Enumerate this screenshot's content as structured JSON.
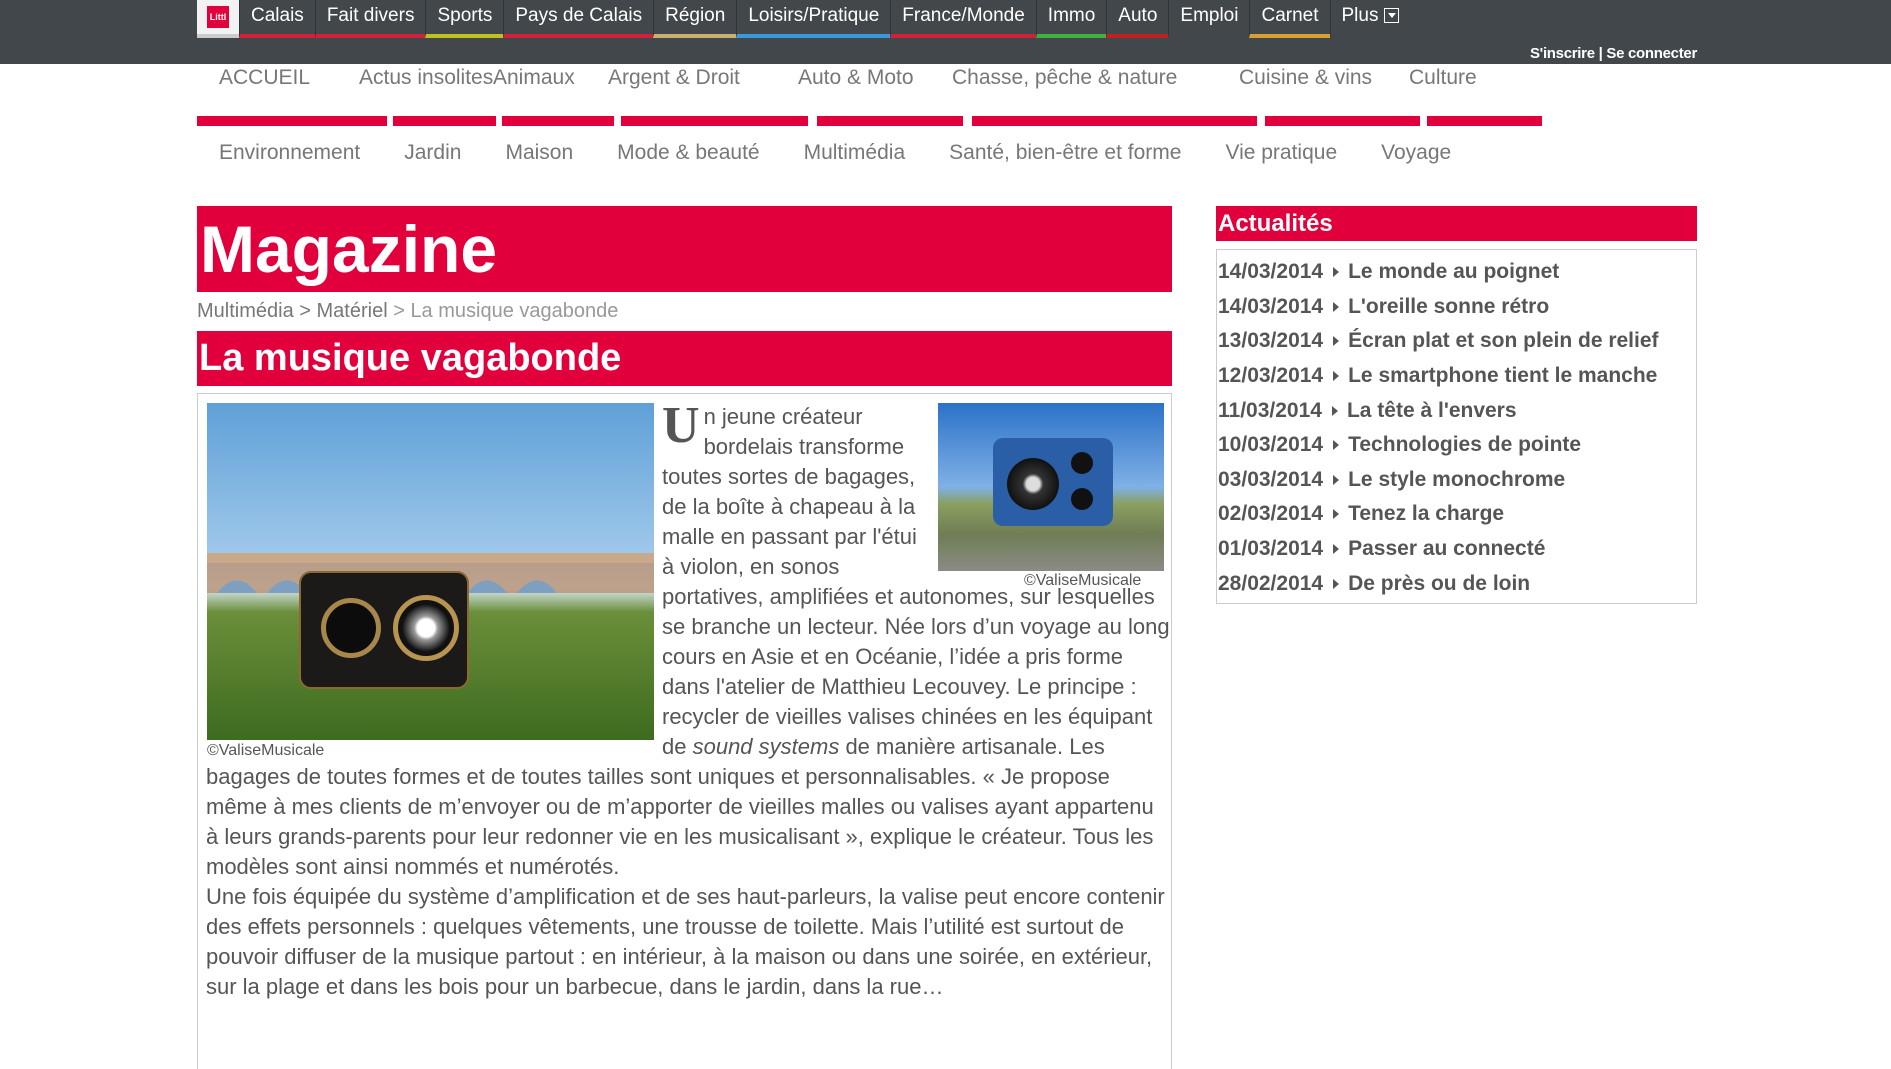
{
  "topnav": {
    "logo_text": "Nord Littoral",
    "tabs": [
      {
        "label": "Calais",
        "color": "#d0203a"
      },
      {
        "label": "Fait divers",
        "color": "#d0203a"
      },
      {
        "label": "Sports",
        "color": "#c0c020"
      },
      {
        "label": "Pays de Calais",
        "color": "#d0203a"
      },
      {
        "label": "Région",
        "color": "#c8b070"
      },
      {
        "label": "Loisirs/Pratique",
        "color": "#3a9ad9"
      },
      {
        "label": "France/Monde",
        "color": "#d0203a"
      },
      {
        "label": "Immo",
        "color": "#40b040"
      },
      {
        "label": "Auto",
        "color": "#c02020"
      },
      {
        "label": "Emploi",
        "color": "#41474b"
      },
      {
        "label": "Carnet",
        "color": "#d8a030"
      },
      {
        "label": "Plus",
        "color": "#41474b"
      }
    ],
    "auth": {
      "signup": "S'inscrire",
      "separator": " | ",
      "login": "Se connecter"
    }
  },
  "categories": {
    "row1": [
      "ACCUEIL",
      "Actus insolites",
      "Animaux",
      "Argent & Droit",
      "Auto & Moto",
      "Chasse, pêche & nature",
      "Cuisine & vins",
      "Culture"
    ],
    "row2": [
      "Environnement",
      "Jardin",
      "Maison",
      "Mode & beauté",
      "Multimédia",
      "Santé, bien-être et forme",
      "Vie pratique",
      "Voyage"
    ]
  },
  "main": {
    "section_title": "Magazine",
    "breadcrumb": {
      "part1": "Multimédia",
      "sep": " > ",
      "part2": "Matériel",
      "current": "La musique vagabonde"
    },
    "article_title": "La musique vagabonde",
    "photo_left_caption": "©ValiseMusicale",
    "photo_right_caption": "©ValiseMusicale",
    "dropcap": "U",
    "para1_start": "n jeune créateur bordelais transforme toutes sortes de bagages, de la boîte à chapeau à la malle en passant par l'étui à violon, en sonos portatives, amplifiées et autonomes, sur lesquelles se branche un lecteur. Née lors d’un voyage au long cours en Asie et en Océanie, l’idée a pris forme dans l'atelier de Matthieu Lecouvey. Le principe : recycler de vieilles valises chinées en les équipant de ",
    "para1_em": "sound systems",
    "para1_end": " de manière artisanale. Les bagages de toutes formes et de toutes tailles sont uniques et personnalisables. « Je propose même à mes clients de m’envoyer ou de m’apporter de vieilles malles ou valises ayant appartenu à leurs grands-parents pour leur redonner vie en les musicalisant », explique le créateur. Tous les modèles sont ainsi nommés et numérotés.",
    "para2": "Une fois équipée du système d’amplification et de ses haut-parleurs, la valise peut encore contenir des effets personnels : quelques vêtements, une trousse de toilette. Mais l’utilité est surtout de pouvoir diffuser de la musique partout : en intérieur, à la maison ou dans une soirée, en extérieur, sur la plage et dans les bois pour un barbecue, dans le jardin, dans la rue…"
  },
  "sidebar": {
    "title": "Actualités",
    "items": [
      {
        "date": "14/03/2014",
        "title": "Le monde au poignet"
      },
      {
        "date": "14/03/2014",
        "title": "L'oreille sonne rétro"
      },
      {
        "date": "13/03/2014",
        "title": "Écran plat et son plein de relief"
      },
      {
        "date": "12/03/2014",
        "title": "Le smartphone tient le manche"
      },
      {
        "date": "11/03/2014",
        "title": "La tête à l'envers"
      },
      {
        "date": "10/03/2014",
        "title": "Technologies de pointe"
      },
      {
        "date": "03/03/2014",
        "title": "Le style monochrome"
      },
      {
        "date": "02/03/2014",
        "title": "Tenez la charge"
      },
      {
        "date": "01/03/2014",
        "title": "Passer au connecté"
      },
      {
        "date": "28/02/2014",
        "title": "De près ou de loin"
      }
    ]
  },
  "colors": {
    "brand_red": "#e2003c",
    "topbar": "#41474b"
  }
}
